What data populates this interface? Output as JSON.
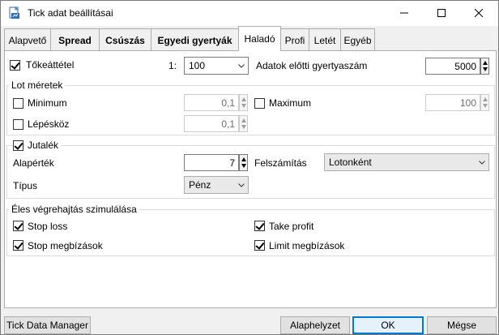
{
  "window": {
    "title": "Tick adat beállításai",
    "app_icon": "tick-data-icon",
    "controls": {
      "minimize": "minimize-icon",
      "maximize": "maximize-icon",
      "close": "close-icon"
    }
  },
  "tabs": [
    {
      "label": "Alapvető",
      "bold": false,
      "active": false
    },
    {
      "label": "Spread",
      "bold": true,
      "active": false
    },
    {
      "label": "Csúszás",
      "bold": true,
      "active": false
    },
    {
      "label": "Egyedi gyertyák",
      "bold": true,
      "active": false
    },
    {
      "label": "Haladó",
      "bold": false,
      "active": true
    },
    {
      "label": "Profi",
      "bold": false,
      "active": false
    },
    {
      "label": "Letét",
      "bold": false,
      "active": false
    },
    {
      "label": "Egyéb",
      "bold": false,
      "active": false
    }
  ],
  "top_row": {
    "tokeattetel_label": "Tőkeáttétel",
    "tokeattetel_checked": true,
    "ratio_prefix": "1:",
    "leverage_value": "100",
    "candles_label": "Adatok előtti gyertyaszám",
    "candles_value": "5000"
  },
  "lot": {
    "title": "Lot méretek",
    "minimum_label": "Minimum",
    "minimum_value": "0,1",
    "maximum_label": "Maximum",
    "maximum_value": "100",
    "step_label": "Lépésköz",
    "step_value": "0,1"
  },
  "jutalek": {
    "title": "Jutalék",
    "checked": true,
    "base_label": "Alapérték",
    "base_value": "7",
    "calc_label": "Felszámítás",
    "calc_value": "Lotonként",
    "type_label": "Típus",
    "type_value": "Pénz"
  },
  "sim": {
    "title": "Éles végrehajtás szimulálása",
    "stop_loss": "Stop loss",
    "take_profit": "Take profit",
    "stop_orders": "Stop megbízások",
    "limit_orders": "Limit megbízások"
  },
  "footer": {
    "manager": "Tick Data Manager",
    "reset": "Alaphelyzet",
    "ok": "OK",
    "cancel": "Mégse"
  }
}
